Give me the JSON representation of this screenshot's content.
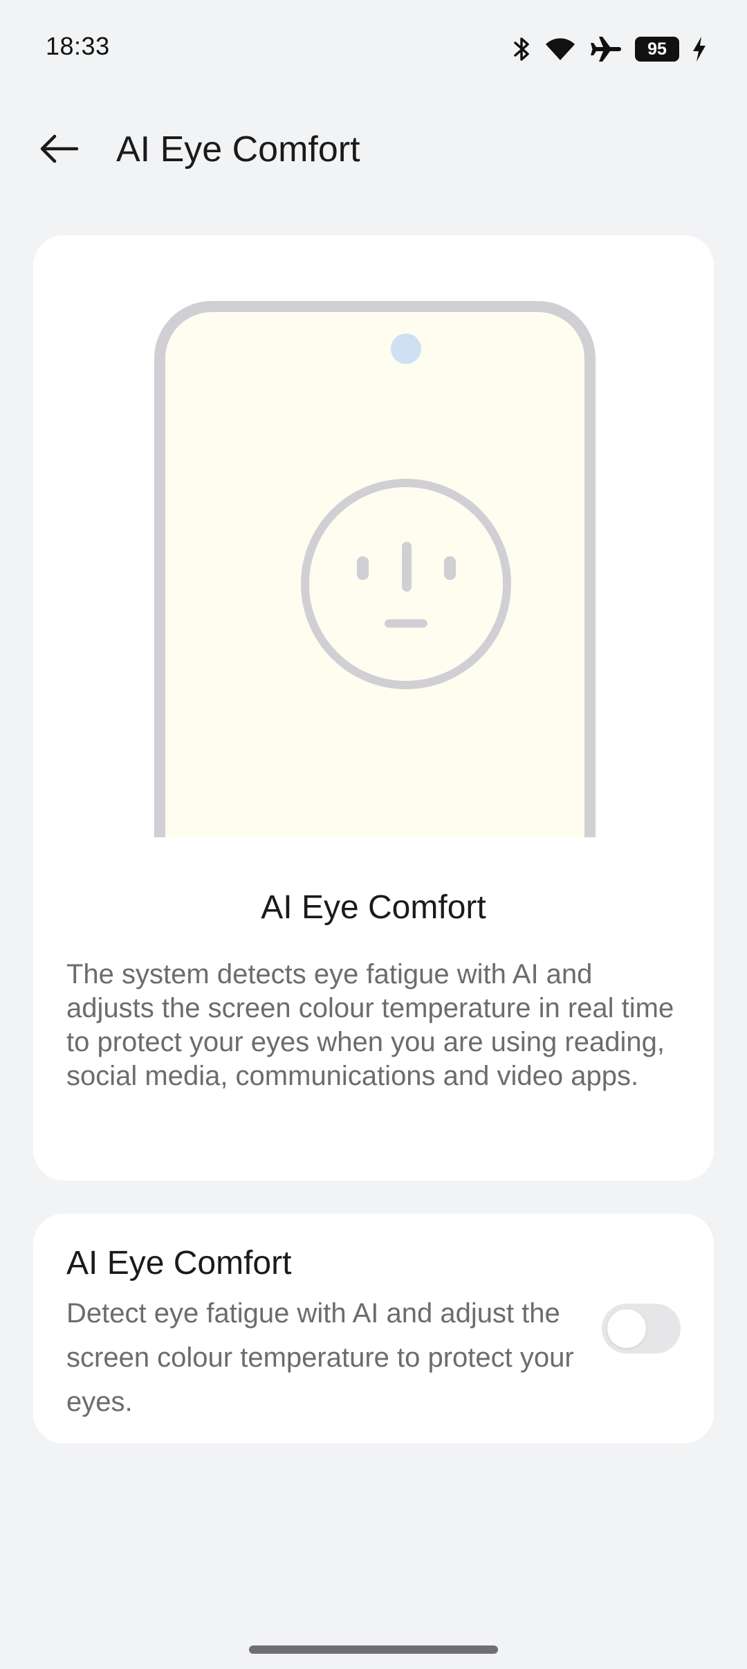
{
  "status_bar": {
    "time": "18:33",
    "battery_level": "95",
    "icons": [
      "bluetooth-icon",
      "wifi-icon",
      "airplane-icon",
      "battery-icon",
      "charging-icon"
    ]
  },
  "app_bar": {
    "back_icon": "arrow-left-icon",
    "title": "AI Eye Comfort"
  },
  "intro_card": {
    "illustration": "phone-face-illustration",
    "title": "AI Eye Comfort",
    "description": "The system detects eye fatigue with AI and adjusts the screen colour temperature in real time to protect your eyes when you are using reading, social media, communications and video apps."
  },
  "setting": {
    "title": "AI Eye Comfort",
    "description": "Detect eye fatigue with AI and adjust the screen colour temperature to protect your eyes.",
    "enabled": false
  },
  "colors": {
    "background": "#f2f3f5",
    "card": "#ffffff",
    "screen_fill": "#fefdf0",
    "outline": "#cfcfd4",
    "camera": "#cfe0f2",
    "secondary_text": "#6b6b70"
  }
}
